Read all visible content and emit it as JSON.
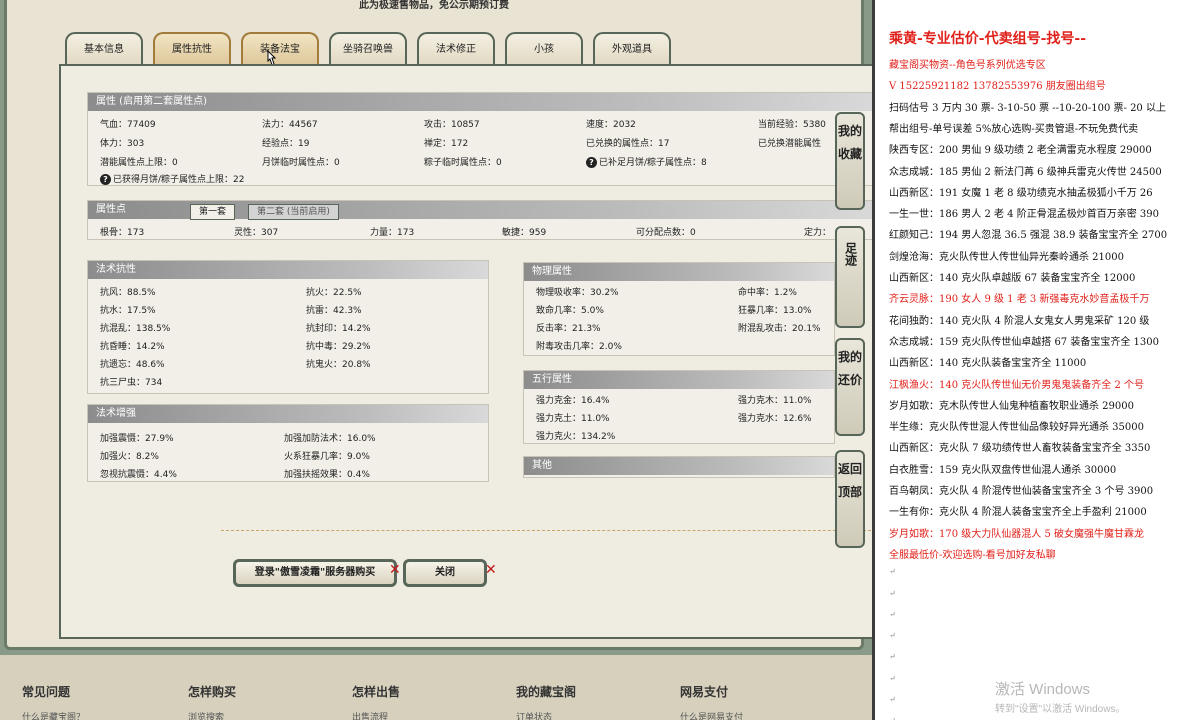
{
  "notice": "此为极速售物品，免公示期预订费",
  "tabs": [
    "基本信息",
    "属性抗性",
    "装备法宝",
    "坐骑召唤兽",
    "法术修正",
    "小孩",
    "外观道具"
  ],
  "attr_section": {
    "title": "属性 (启用第二套属性点)",
    "rows": [
      [
        "气血：77409",
        "法力：44567",
        "攻击：10857",
        "速度：2032",
        "当前经验：5380"
      ],
      [
        "体力：303",
        "经验点：19",
        "禅定：172",
        "已兑换的属性点：17",
        "已兑换潜能属性"
      ],
      [
        "潜能属性点上限：0",
        "月饼临时属性点：0",
        "粽子临时属性点：0",
        "已补足月饼/粽子属性点：8",
        ""
      ]
    ],
    "note": "已获得月饼/粽子属性点上限：22"
  },
  "points_section": {
    "title": "属性点",
    "subtabs": [
      "第一套",
      "第二套 (当前启用)"
    ],
    "row": [
      "根骨：173",
      "灵性：307",
      "力量：173",
      "敏捷：959",
      "可分配点数：0",
      "定力："
    ]
  },
  "magic_resist": {
    "title": "法术抗性",
    "left": [
      "抗风：88.5%",
      "抗水：17.5%",
      "抗混乱：138.5%",
      "抗昏睡：14.2%",
      "抗遗忘：48.6%",
      "抗三尸虫：734"
    ],
    "right": [
      "抗火：22.5%",
      "抗雷：42.3%",
      "抗封印：14.2%",
      "抗中毒：29.2%",
      "抗鬼火：20.8%"
    ]
  },
  "magic_boost": {
    "title": "法术增强",
    "left": [
      "加强震慑：27.9%",
      "加强火：8.2%",
      "忽视抗震慑：4.4%"
    ],
    "right": [
      "加强加防法术：16.0%",
      "火系狂暴几率：9.0%",
      "加强扶摇效果：0.4%"
    ]
  },
  "physical": {
    "title": "物理属性",
    "left": [
      "物理吸收率：30.2%",
      "致命几率：5.0%",
      "反击率：21.3%",
      "附毒攻击几率：2.0%"
    ],
    "right": [
      "命中率：1.2%",
      "狂暴几率：13.0%",
      "附混乱攻击：20.1%"
    ]
  },
  "wuxing": {
    "title": "五行属性",
    "left": [
      "强力克金：16.4%",
      "强力克土：11.0%",
      "强力克火：134.2%"
    ],
    "right": [
      "强力克木：11.0%",
      "强力克水：12.6%"
    ]
  },
  "other": {
    "title": "其他"
  },
  "side_buttons": [
    "我的收藏",
    "足迹",
    "我的还价",
    "返回顶部"
  ],
  "buy_button": "登录\"傲雪凌霜\"服务器购买",
  "close_button": "关闭",
  "footer": [
    {
      "title": "常见问题",
      "sub": "什么是藏宝阁？"
    },
    {
      "title": "怎样购买",
      "sub": "浏览搜索"
    },
    {
      "title": "怎样出售",
      "sub": "出售流程"
    },
    {
      "title": "我的藏宝阁",
      "sub": "订单状态"
    },
    {
      "title": "网易支付",
      "sub": "什么是网易支付"
    }
  ],
  "doc": {
    "title": "乘黄-专业估价-代卖组号-找号--",
    "lines": [
      {
        "text": "藏宝阁买物资--角色号系列优选专区",
        "color": "red"
      },
      {
        "text": "V 15225921182   13782553976 朋友圈出组号",
        "color": "red"
      },
      {
        "text": "扫码估号 3 万内 30 票- 3-10-50 票  --10-20-100 票- 20 以上",
        "color": "black"
      },
      {
        "text": "帮出组号-单号误差 5%放心选购-买贵管退-不玩免费代卖",
        "color": "black"
      },
      {
        "text": "陕西专区：200 男仙 9 级功绩 2 老全满雷克水程度 29000",
        "color": "black"
      },
      {
        "text": "众志成城：185 男仙 2 新法门苒 6 级神兵雷克火传世 24500",
        "color": "black"
      },
      {
        "text": "山西新区：191 女魔 1 老 8 级功绩克水抽孟极狐小千万 26",
        "color": "black"
      },
      {
        "text": "一生一世：186 男人 2 老 4 阶正骨混孟极炒首百万亲密 390",
        "color": "black"
      },
      {
        "text": "红颜知己：194 男人忽混 36.5 强混 38.9 装备宝宝齐全 2700",
        "color": "black"
      },
      {
        "text": "剑煌沧海：克火队传世人传世仙异光秦岭通杀 21000",
        "color": "black"
      },
      {
        "text": "山西新区：140 克火队卓越版 67 装备宝宝齐全 12000",
        "color": "black"
      },
      {
        "text": "齐云灵脉：190 女人 9 级 1 老 3 新强毒克水妙音孟极千万",
        "color": "red"
      },
      {
        "text": "花间独酌：140 克火队 4 阶混人女鬼女人男鬼采矿 120 级",
        "color": "black"
      },
      {
        "text": "众志成城：159 克火队传世仙卓越搭 67 装备宝宝齐全 1300",
        "color": "black"
      },
      {
        "text": "山西新区：140 克火队装备宝宝齐全 11000",
        "color": "black"
      },
      {
        "text": "江枫渔火：140 克火队传世仙无价男鬼鬼装备齐全 2 个号",
        "color": "red"
      },
      {
        "text": "岁月如歌：克木队传世人仙鬼种植畜牧职业通杀 29000",
        "color": "black"
      },
      {
        "text": "半生缘：克火队传世混人传世仙品像较好异光通杀 35000",
        "color": "black"
      },
      {
        "text": "山西新区：克火队 7 级功绩传世人畜牧装备宝宝齐全 3350",
        "color": "black"
      },
      {
        "text": "白衣胜雪：159 克火队双盘传世仙混人通杀 30000",
        "color": "black"
      },
      {
        "text": "百鸟朝凤：克火队 4 阶混传世仙装备宝宝齐全 3 个号 3900",
        "color": "black"
      },
      {
        "text": "一生有你：克火队 4 阶混人装备宝宝齐全上手盈利 21000",
        "color": "black"
      },
      {
        "text": "岁月如歌：170 级大力队仙器混人 5 破女魔强牛魔甘霖龙",
        "color": "red"
      },
      {
        "text": "全服最低价-欢迎选购-看号加好友私聊",
        "color": "red"
      }
    ]
  },
  "watermark": "激活 Windows",
  "watermark_sub": "转到\"设置\"以激活 Windows。"
}
